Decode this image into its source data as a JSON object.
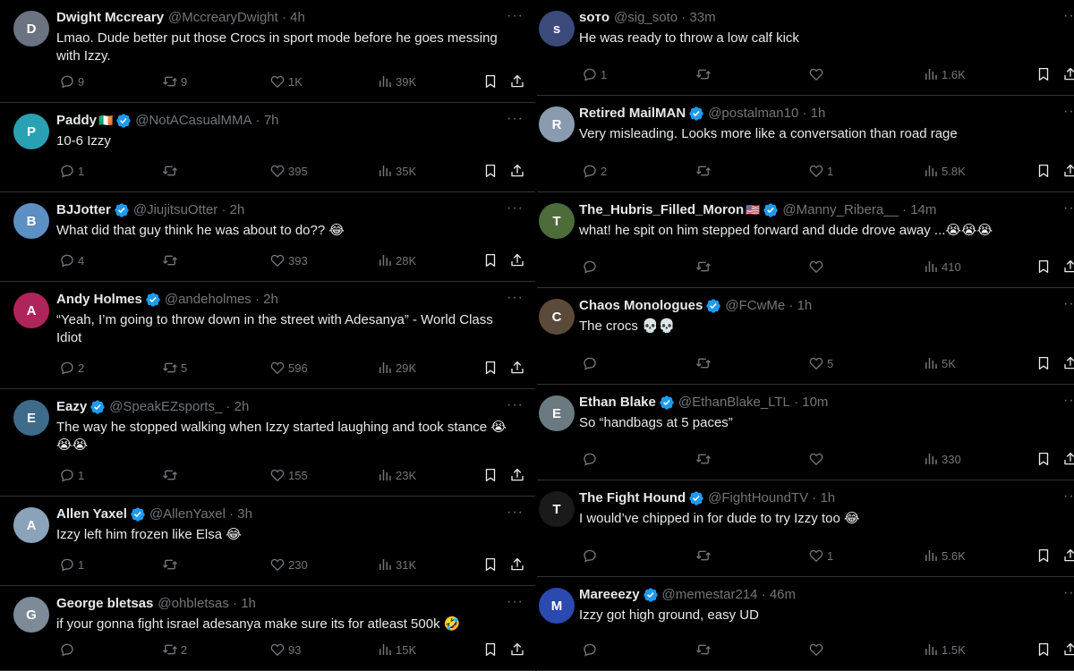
{
  "left": [
    {
      "name": "Dwight Mccreary",
      "verified": false,
      "flag": "",
      "handle": "@MccrearyDwight",
      "time": "4h",
      "text": "Lmao. Dude better put those Crocs in sport mode before he goes messing with Izzy.",
      "replies": "9",
      "reposts": "9",
      "likes": "1K",
      "views": "39K",
      "avatar_color": "#6b7280"
    },
    {
      "name": "Paddy",
      "verified": true,
      "flag": "🇮🇪",
      "handle": "@NotACasualMMA",
      "time": "7h",
      "text": "10-6 Izzy",
      "replies": "1",
      "reposts": "",
      "likes": "395",
      "views": "35K",
      "avatar_color": "#2aa1b3"
    },
    {
      "name": "BJJotter",
      "verified": true,
      "flag": "",
      "handle": "@JiujitsuOtter",
      "time": "2h",
      "text": "What did that guy think he was about to do?? 😂",
      "replies": "4",
      "reposts": "",
      "likes": "393",
      "views": "28K",
      "avatar_color": "#5c8fc2"
    },
    {
      "name": "Andy Holmes",
      "verified": true,
      "flag": "",
      "handle": "@andeholmes",
      "time": "2h",
      "text": "“Yeah, I’m going to throw down in the street with Adesanya” - World Class Idiot",
      "replies": "2",
      "reposts": "5",
      "likes": "596",
      "views": "29K",
      "avatar_color": "#b0245c"
    },
    {
      "name": "Eazy",
      "verified": true,
      "flag": "",
      "handle": "@SpeakEZsports_",
      "time": "2h",
      "text": "The way he stopped walking when Izzy started laughing and took stance 😭😭😭",
      "replies": "1",
      "reposts": "",
      "likes": "155",
      "views": "23K",
      "avatar_color": "#3e6b8a"
    },
    {
      "name": "Allen Yaxel",
      "verified": true,
      "flag": "",
      "handle": "@AllenYaxel",
      "time": "3h",
      "text": "Izzy left him frozen like Elsa 😂",
      "replies": "1",
      "reposts": "",
      "likes": "230",
      "views": "31K",
      "avatar_color": "#8aa3b8"
    },
    {
      "name": "George bletsas",
      "verified": false,
      "flag": "",
      "handle": "@ohbletsas",
      "time": "1h",
      "text": "if your gonna fight israel adesanya make sure its for atleast 500k 🤣",
      "replies": "",
      "reposts": "2",
      "likes": "93",
      "views": "15K",
      "avatar_color": "#7d8b99"
    }
  ],
  "right": [
    {
      "name": "sᴏᴛᴏ",
      "verified": false,
      "flag": "",
      "handle": "@sig_soto",
      "time": "33m",
      "text": "He was ready to throw a low calf kick",
      "replies": "1",
      "reposts": "",
      "likes": "",
      "views": "1.6K",
      "avatar_color": "#3b4a7a"
    },
    {
      "name": "Retired MailMAN",
      "verified": true,
      "flag": "",
      "handle": "@postalman10",
      "time": "1h",
      "text": "Very misleading. Looks more like a conversation than road rage",
      "replies": "2",
      "reposts": "",
      "likes": "1",
      "views": "5.8K",
      "avatar_color": "#8a9bb0"
    },
    {
      "name": "The_Hubris_Filled_Moron",
      "verified": true,
      "flag": "🇺🇸",
      "handle": "@Manny_Ribera__",
      "time": "14m",
      "text": "what! he spit on him stepped forward and dude drove away ...😭😭😭",
      "replies": "",
      "reposts": "",
      "likes": "",
      "views": "410",
      "avatar_color": "#4e6b3a"
    },
    {
      "name": "Chaos Monologues",
      "verified": true,
      "flag": "",
      "handle": "@FCwMe",
      "time": "1h",
      "text": "The crocs 💀💀",
      "replies": "",
      "reposts": "",
      "likes": "5",
      "views": "5K",
      "avatar_color": "#5a4a3a"
    },
    {
      "name": "Ethan Blake",
      "verified": true,
      "flag": "",
      "handle": "@EthanBlake_LTL",
      "time": "10m",
      "text": "So “handbags at 5 paces”",
      "replies": "",
      "reposts": "",
      "likes": "",
      "views": "330",
      "avatar_color": "#6a7a80"
    },
    {
      "name": "The Fight Hound",
      "verified": true,
      "flag": "",
      "handle": "@FightHoundTV",
      "time": "1h",
      "text": "I would’ve chipped in for dude to try Izzy too 😂",
      "replies": "",
      "reposts": "",
      "likes": "1",
      "views": "5.6K",
      "avatar_color": "#1a1a1a"
    },
    {
      "name": "Mareeezy",
      "verified": true,
      "flag": "",
      "handle": "@memestar214",
      "time": "46m",
      "text": "Izzy got high ground, easy UD",
      "replies": "",
      "reposts": "",
      "likes": "",
      "views": "1.5K",
      "avatar_color": "#2a4ab0"
    }
  ],
  "icons": {
    "reply": "reply-icon",
    "repost": "repost-icon",
    "like": "like-icon",
    "views": "views-icon",
    "bookmark": "bookmark-icon",
    "share": "share-icon",
    "more": "more-icon",
    "verified": "verified-badge-icon"
  },
  "colors": {
    "background": "#000000",
    "text": "#e7e9ea",
    "muted": "#71767b",
    "divider": "#2f3336",
    "verified": "#1d9bf0"
  },
  "more_glyph": "···"
}
